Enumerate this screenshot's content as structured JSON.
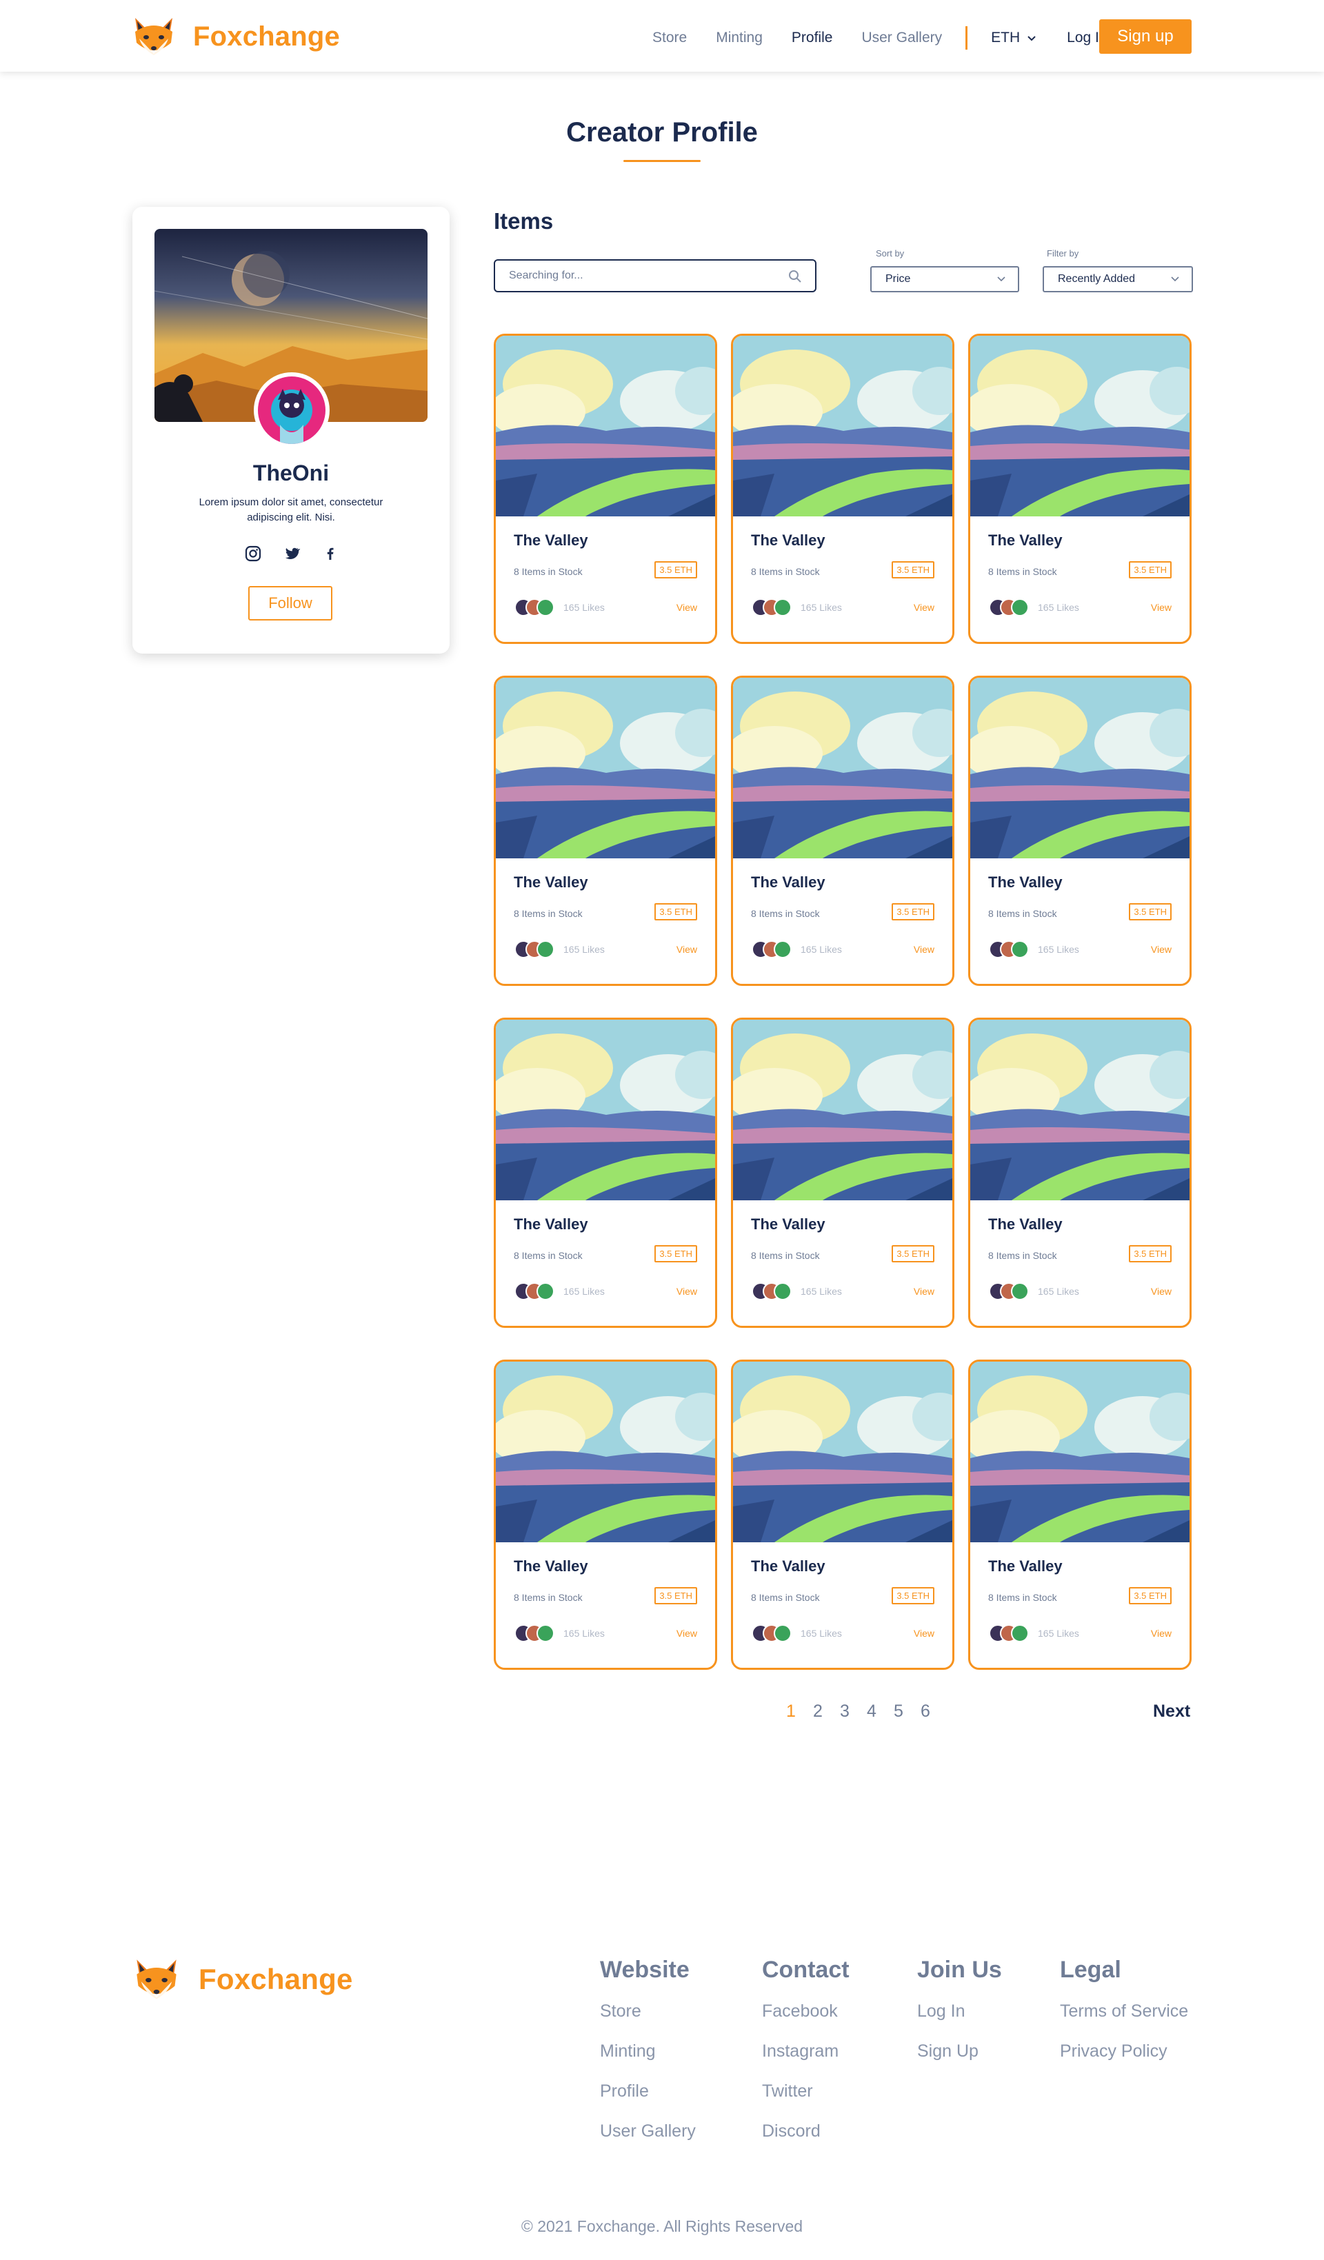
{
  "brand": {
    "name": "Foxchange",
    "accent": "#f7931e",
    "navy": "#1b2a4e"
  },
  "nav": {
    "items": [
      {
        "label": "Store"
      },
      {
        "label": "Minting"
      },
      {
        "label": "Profile",
        "active": true
      },
      {
        "label": "User Gallery"
      }
    ],
    "currency": "ETH",
    "login": "Log In",
    "signup": "Sign up"
  },
  "page": {
    "title": "Creator Profile"
  },
  "profile": {
    "username": "TheOni",
    "bio": "Lorem ipsum dolor sit amet, consectetur adipiscing elit. Nisi.",
    "socials": [
      "instagram-icon",
      "twitter-icon",
      "facebook-icon"
    ],
    "follow_label": "Follow"
  },
  "items": {
    "heading": "Items",
    "search_placeholder": "Searching for...",
    "sort": {
      "label": "Sort by",
      "value": "Price"
    },
    "filter": {
      "label": "Filter by",
      "value": "Recently Added"
    },
    "cards": [
      {
        "name": "The Valley",
        "stock": "8 Items in Stock",
        "price": "3.5 ETH",
        "likes": "165 Likes",
        "view": "View"
      },
      {
        "name": "The Valley",
        "stock": "8 Items in Stock",
        "price": "3.5 ETH",
        "likes": "165 Likes",
        "view": "View"
      },
      {
        "name": "The Valley",
        "stock": "8 Items in Stock",
        "price": "3.5 ETH",
        "likes": "165 Likes",
        "view": "View"
      },
      {
        "name": "The Valley",
        "stock": "8 Items in Stock",
        "price": "3.5 ETH",
        "likes": "165 Likes",
        "view": "View"
      },
      {
        "name": "The Valley",
        "stock": "8 Items in Stock",
        "price": "3.5 ETH",
        "likes": "165 Likes",
        "view": "View"
      },
      {
        "name": "The Valley",
        "stock": "8 Items in Stock",
        "price": "3.5 ETH",
        "likes": "165 Likes",
        "view": "View"
      },
      {
        "name": "The Valley",
        "stock": "8 Items in Stock",
        "price": "3.5 ETH",
        "likes": "165 Likes",
        "view": "View"
      },
      {
        "name": "The Valley",
        "stock": "8 Items in Stock",
        "price": "3.5 ETH",
        "likes": "165 Likes",
        "view": "View"
      },
      {
        "name": "The Valley",
        "stock": "8 Items in Stock",
        "price": "3.5 ETH",
        "likes": "165 Likes",
        "view": "View"
      },
      {
        "name": "The Valley",
        "stock": "8 Items in Stock",
        "price": "3.5 ETH",
        "likes": "165 Likes",
        "view": "View"
      },
      {
        "name": "The Valley",
        "stock": "8 Items in Stock",
        "price": "3.5 ETH",
        "likes": "165 Likes",
        "view": "View"
      },
      {
        "name": "The Valley",
        "stock": "8 Items in Stock",
        "price": "3.5 ETH",
        "likes": "165 Likes",
        "view": "View"
      }
    ]
  },
  "pagination": {
    "pages": [
      "1",
      "2",
      "3",
      "4",
      "5",
      "6"
    ],
    "current": "1",
    "next": "Next"
  },
  "footer": {
    "columns": [
      {
        "title": "Website",
        "links": [
          "Store",
          "Minting",
          "Profile",
          "User Gallery"
        ]
      },
      {
        "title": "Contact",
        "links": [
          "Facebook",
          "Instagram",
          "Twitter",
          "Discord"
        ]
      },
      {
        "title": "Join Us",
        "links": [
          "Log In",
          "Sign Up"
        ]
      },
      {
        "title": "Legal",
        "links": [
          "Terms of Service",
          "Privacy Policy"
        ]
      }
    ],
    "copyright": "© 2021 Foxchange. All Rights Reserved"
  }
}
